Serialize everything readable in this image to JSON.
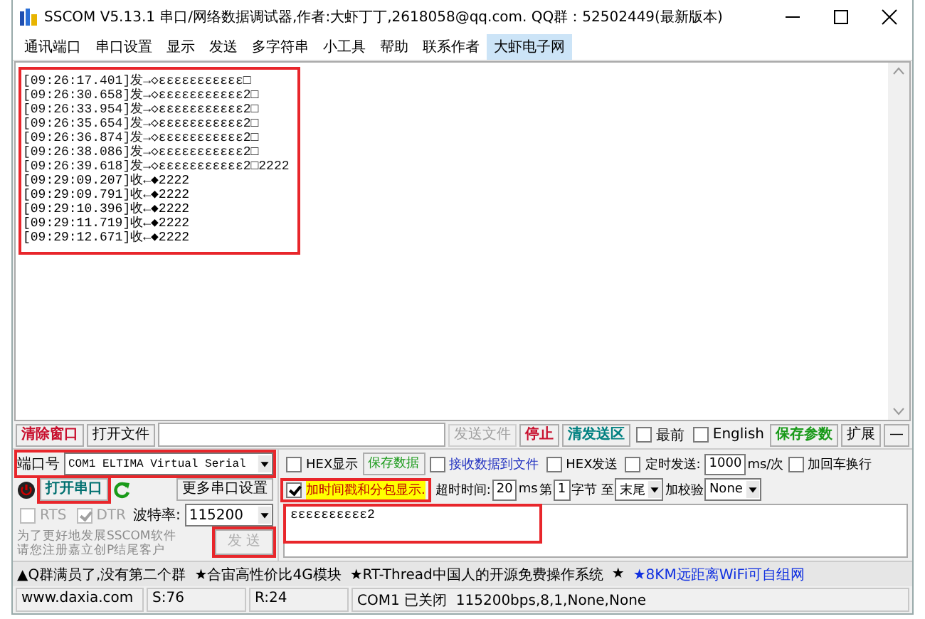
{
  "window": {
    "title": "SSCOM V5.13.1 串口/网络数据调试器,作者:大虾丁丁,2618058@qq.com. QQ群：52502449(最新版本)"
  },
  "menu": [
    {
      "label": "通讯端口",
      "selected": false
    },
    {
      "label": "串口设置",
      "selected": false
    },
    {
      "label": "显示",
      "selected": false
    },
    {
      "label": "发送",
      "selected": false
    },
    {
      "label": "多字符串",
      "selected": false
    },
    {
      "label": "小工具",
      "selected": false
    },
    {
      "label": "帮助",
      "selected": false
    },
    {
      "label": "联系作者",
      "selected": false
    },
    {
      "label": "大虾电子网",
      "selected": true
    }
  ],
  "log": {
    "highlighted": true,
    "lines": [
      {
        "kind": "send",
        "text": "[09:26:17.401]发→◇εεεεεεεεεεε□"
      },
      {
        "kind": "send",
        "text": "[09:26:30.658]发→◇εεεεεεεεεεε2□"
      },
      {
        "kind": "send",
        "text": "[09:26:33.954]发→◇εεεεεεεεεεε2□"
      },
      {
        "kind": "send",
        "text": "[09:26:35.654]发→◇εεεεεεεεεεε2□"
      },
      {
        "kind": "send",
        "text": "[09:26:36.874]发→◇εεεεεεεεεεε2□"
      },
      {
        "kind": "send",
        "text": "[09:26:38.086]发→◇εεεεεεεεεεε2□"
      },
      {
        "kind": "send",
        "text": "[09:26:39.618]发→◇εεεεεεεεεεε2□2222"
      },
      {
        "kind": "receive",
        "text": "[09:29:09.207]收←◆2222"
      },
      {
        "kind": "receive",
        "text": "[09:29:09.791]收←◆2222"
      },
      {
        "kind": "receive",
        "text": "[09:29:10.396]收←◆2222"
      },
      {
        "kind": "receive",
        "text": "[09:29:11.719]收←◆2222"
      },
      {
        "kind": "receive",
        "text": "[09:29:12.671]收←◆2222"
      }
    ]
  },
  "toolbar": [
    {
      "kind": "button",
      "label": "清除窗口",
      "color": "#c8102e",
      "disabled": false
    },
    {
      "kind": "button",
      "label": "打开文件",
      "color": "#000000",
      "disabled": false
    },
    {
      "kind": "field"
    },
    {
      "kind": "button",
      "label": "发送文件",
      "color": "#a0a0a0",
      "disabled": true
    },
    {
      "kind": "button",
      "label": "停止",
      "color": "#c8102e",
      "disabled": false
    },
    {
      "kind": "button",
      "label": "清发送区",
      "color": "#008080",
      "disabled": false
    },
    {
      "kind": "checkbox",
      "label": "最前",
      "checked": false
    },
    {
      "kind": "checkbox",
      "label": "English",
      "checked": false
    },
    {
      "kind": "button",
      "label": "保存参数",
      "color": "#1a9a1a",
      "disabled": false
    },
    {
      "kind": "button",
      "label": "扩展",
      "color": "#000000",
      "disabled": false
    },
    {
      "kind": "button",
      "label": "—",
      "color": "#000000",
      "disabled": false
    }
  ],
  "port_panel": {
    "port_label": "端口号",
    "port_value": "COM1 ELTIMA Virtual Serial",
    "port_highlighted": true,
    "open_button": {
      "label": "打开串口",
      "highlighted": true
    },
    "more_settings": "更多串口设置",
    "rts": {
      "label": "RTS",
      "checked": false
    },
    "dtr": {
      "label": "DTR",
      "checked": true
    },
    "baud_label": "波特率:",
    "baud_value": "115200",
    "promo": [
      "为了更好地发展SSCOM软件",
      "请您注册嘉立创P结尾客户"
    ],
    "send_button": {
      "label": "发 送",
      "disabled": true,
      "highlighted": true
    }
  },
  "options": [
    [
      {
        "kind": "checkbox",
        "label": "HEX显示",
        "checked": false
      },
      {
        "kind": "button",
        "label": "保存数据",
        "color": "#1a9a1a"
      },
      {
        "kind": "checkbox",
        "label": "接收数据到文件",
        "checked": false,
        "color": "#2030c0"
      },
      {
        "kind": "checkbox",
        "label": "HEX发送",
        "checked": false
      },
      {
        "kind": "checkbox",
        "label": "定时发送:",
        "checked": false
      },
      {
        "kind": "field",
        "value": "1000"
      },
      {
        "kind": "label",
        "text": "ms/次"
      },
      {
        "kind": "checkbox",
        "label": "加回车换行",
        "checked": false
      }
    ],
    [
      {
        "kind": "checkbox",
        "label": "加时间戳和分包显示.",
        "checked": true,
        "highlighted": true
      },
      {
        "kind": "label",
        "text": "超时时间:"
      },
      {
        "kind": "field",
        "value": "20"
      },
      {
        "kind": "label",
        "text": "ms"
      },
      {
        "kind": "label",
        "text": "第"
      },
      {
        "kind": "field",
        "value": "1"
      },
      {
        "kind": "label",
        "text": "字节 至"
      },
      {
        "kind": "select",
        "value": "末尾"
      },
      {
        "kind": "label",
        "text": "加校验"
      },
      {
        "kind": "select",
        "value": "None"
      }
    ]
  ],
  "send_box": {
    "value": "εεεεεεεεεε2",
    "highlighted": true
  },
  "ticker": [
    {
      "text": "▲Q群满员了,没有第二个群",
      "link": false
    },
    {
      "text": "★合宙高性价比4G模块",
      "link": false
    },
    {
      "text": "★RT-Thread中国人的开源免费操作系统",
      "link": false
    },
    {
      "text": "★",
      "link": false
    },
    {
      "text": "★8KM远距离WiFi可自组网",
      "link": true
    }
  ],
  "status_bar": [
    "www.daxia.com",
    "S:76",
    "R:24",
    "COM1 已关闭  115200bps,8,1,None,None"
  ]
}
